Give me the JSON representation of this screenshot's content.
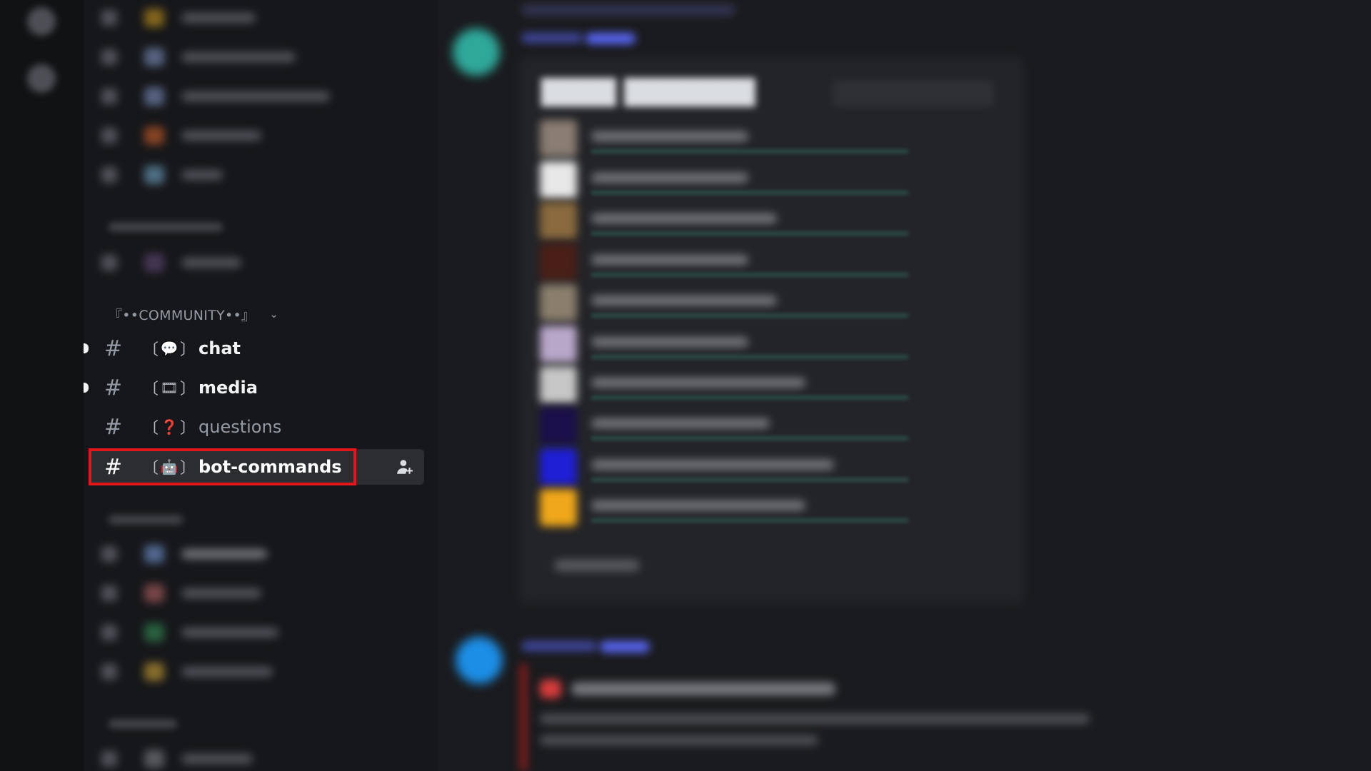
{
  "sidebar": {
    "category": {
      "label": "『••COMMUNITY••』",
      "chevron": "chevron-down-icon"
    },
    "channels": [
      {
        "hash": "#",
        "bracket_open": "〔",
        "emoji": "💬",
        "bracket_close": "〕",
        "label": "chat",
        "unread": true,
        "active": false,
        "muted": false
      },
      {
        "hash": "#",
        "bracket_open": "〔",
        "emoji": "🎞",
        "bracket_close": "〕",
        "label": "media",
        "unread": true,
        "active": false,
        "muted": false
      },
      {
        "hash": "#",
        "bracket_open": "〔",
        "emoji": "❓",
        "bracket_close": "〕",
        "label": "questions",
        "unread": false,
        "active": false,
        "muted": true
      },
      {
        "hash": "#",
        "bracket_open": "〔",
        "emoji": "🤖",
        "bracket_close": "〕",
        "label": "bot-commands",
        "unread": false,
        "active": true,
        "muted": false,
        "action_icon": "create-invite-icon"
      }
    ]
  },
  "colors": {
    "highlight": "#e3161c",
    "sidebar_bg": "#16171a",
    "rail_bg": "#111214",
    "active_bg": "#2b2d31"
  }
}
